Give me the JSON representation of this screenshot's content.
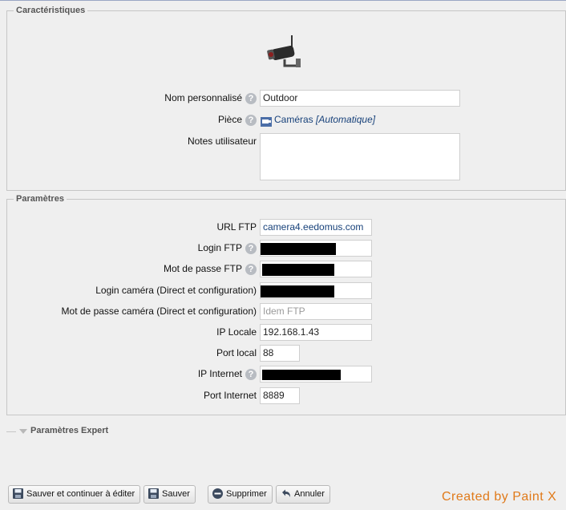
{
  "sections": {
    "caracteristiques": "Caractéristiques",
    "parametres": "Paramètres",
    "expert": "Paramètres Expert"
  },
  "icons": {
    "device": "security-camera-icon",
    "help": "help-icon",
    "room": "camera-room-icon",
    "save": "floppy-disk-icon",
    "delete": "minus-circle-icon",
    "cancel": "undo-arrow-icon",
    "collapse": "triangle-down-icon"
  },
  "caracteristiques": {
    "nom_label": "Nom personnalisé",
    "nom_value": "Outdoor",
    "piece_label": "Pièce",
    "piece_value": "Caméras",
    "piece_auto": "[Automatique]",
    "notes_label": "Notes utilisateur",
    "notes_value": ""
  },
  "parametres": {
    "url_ftp_label": "URL FTP",
    "url_ftp_value": "camera4.eedomus.com",
    "login_ftp_label": "Login FTP",
    "mdp_ftp_label": "Mot de passe FTP",
    "login_cam_label": "Login caméra (Direct et configuration)",
    "mdp_cam_label": "Mot de passe caméra (Direct et configuration)",
    "mdp_cam_placeholder": "Idem FTP",
    "ip_locale_label": "IP Locale",
    "ip_locale_value": "192.168.1.43",
    "port_local_label": "Port local",
    "port_local_value": "88",
    "ip_internet_label": "IP Internet",
    "port_internet_label": "Port Internet",
    "port_internet_value": "8889"
  },
  "help_glyph": "?",
  "buttons": {
    "save_continue": "Sauver et continuer à éditer",
    "save": "Sauver",
    "delete": "Supprimer",
    "cancel": "Annuler"
  },
  "watermark": "Created by Paint X"
}
